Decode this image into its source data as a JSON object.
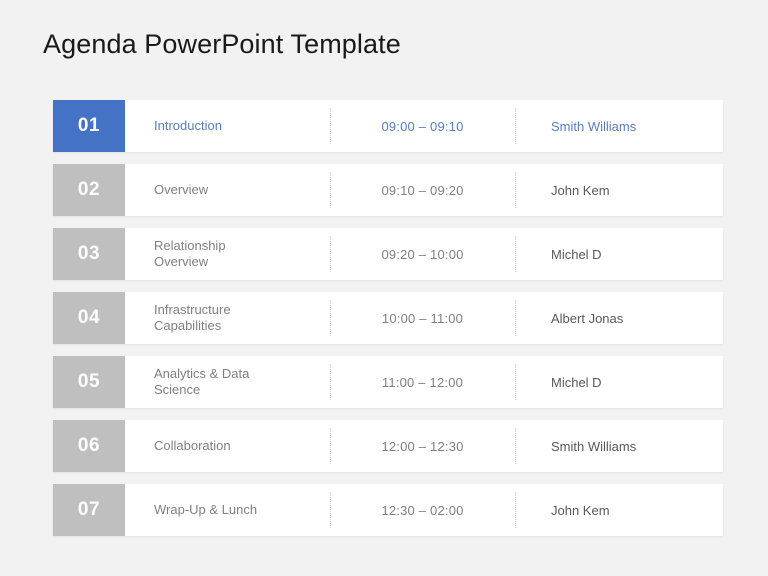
{
  "slide": {
    "title": "Agenda PowerPoint Template",
    "background_color": "#f2f2f2",
    "accent_color": "#4472c4",
    "muted_color": "#bfbfbf"
  },
  "rows": [
    {
      "number": "01",
      "topic_line1": "Introduction",
      "topic_line2": "",
      "time": "09:00 – 09:10",
      "owner": "Smith Williams",
      "active": true
    },
    {
      "number": "02",
      "topic_line1": "Overview",
      "topic_line2": "",
      "time": "09:10 – 09:20",
      "owner": "John Kem",
      "active": false
    },
    {
      "number": "03",
      "topic_line1": "Relationship",
      "topic_line2": "Overview",
      "time": "09:20 – 10:00",
      "owner": "Michel D",
      "active": false
    },
    {
      "number": "04",
      "topic_line1": "Infrastructure",
      "topic_line2": "Capabilities",
      "time": "10:00 – 11:00",
      "owner": "Albert Jonas",
      "active": false
    },
    {
      "number": "05",
      "topic_line1": "Analytics & Data",
      "topic_line2": "Science",
      "time": "11:00 – 12:00",
      "owner": "Michel D",
      "active": false
    },
    {
      "number": "06",
      "topic_line1": "Collaboration",
      "topic_line2": "",
      "time": "12:00 – 12:30",
      "owner": "Smith Williams",
      "active": false
    },
    {
      "number": "07",
      "topic_line1": "Wrap-Up & Lunch",
      "topic_line2": "",
      "time": "12:30 – 02:00",
      "owner": "John Kem",
      "active": false
    }
  ]
}
